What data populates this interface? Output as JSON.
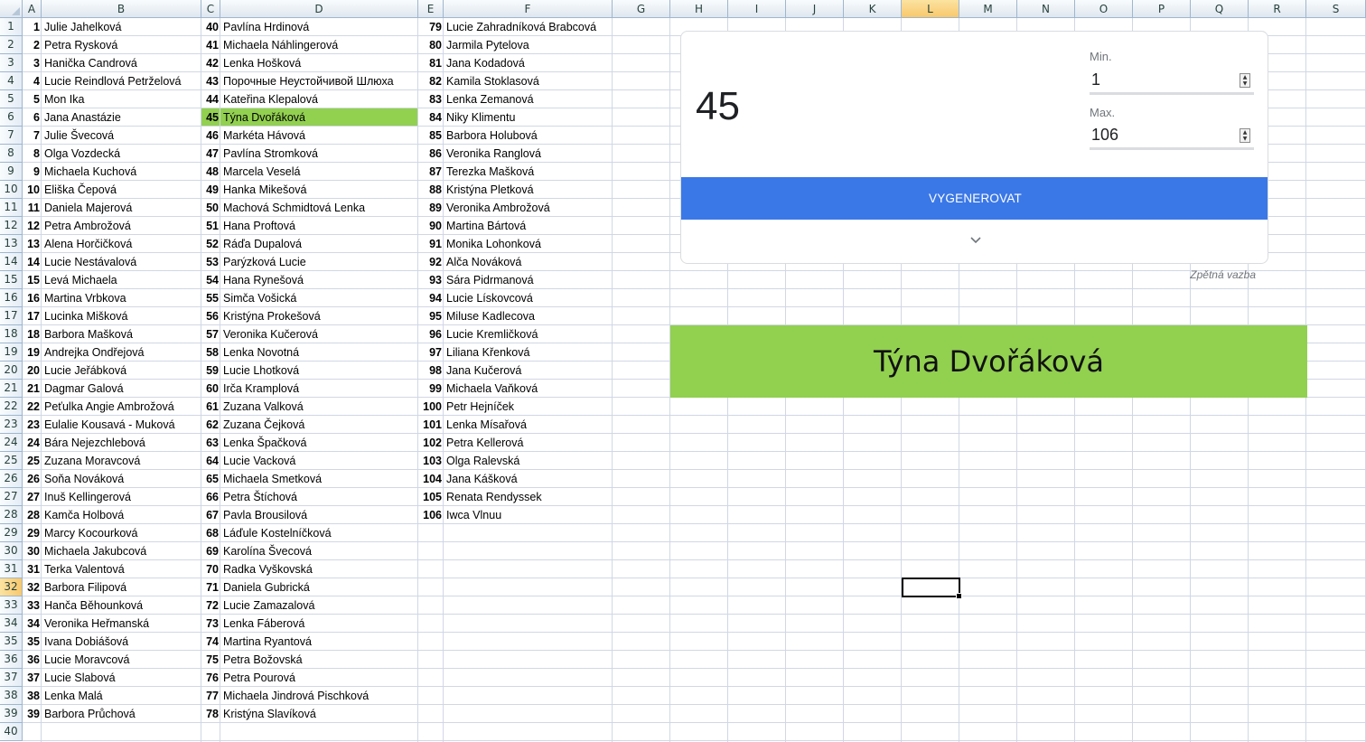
{
  "columns": [
    "A",
    "B",
    "C",
    "D",
    "E",
    "F",
    "G",
    "H",
    "I",
    "J",
    "K",
    "L",
    "M",
    "N",
    "O",
    "P",
    "Q",
    "R",
    "S"
  ],
  "selected_column": "L",
  "selected_row": 32,
  "row_count": 40,
  "col1": [
    "Julie Jahelková",
    "Petra Rysková",
    "Hanička Candrová",
    "Lucie Reindlová Petrželová",
    "Mon Ika",
    "Jana Anastázie",
    "Julie Švecová",
    "Olga Vozdecká",
    "Michaela Kuchová",
    "Eliška Čepová",
    "Daniela Majerová",
    "Petra Ambrožová",
    "Alena Horčičková",
    "Lucie Nestávalová",
    "Levá Michaela",
    "Martina Vrbkova",
    "Lucinka Mišková",
    "Barbora Mašková",
    "Andrejka Ondřejová",
    "Lucie Jeřábková",
    "Dagmar Galová",
    "Peťulka Angie Ambrožová",
    "Eulalie Kousavá - Muková",
    "Bára Nejezchlebová",
    "Zuzana Moravcová",
    "Soňa Nováková",
    "Inuš Kellingerová",
    "Kamča Holbová",
    "Marcy Kocourková",
    "Michaela Jakubcová",
    "Terka Valentová",
    "Barbora Filipová",
    "Hanča Běhounková",
    "Veronika Heřmanská",
    "Ivana Dobiášová",
    "Lucie Moravcová",
    "Lucie Slabová",
    "Lenka Malá",
    "Barbora Průchová"
  ],
  "col2": [
    "Pavlína Hrdinová",
    "Michaela Náhlingerová",
    "Lenka Hošková",
    "Порочные Неустойчивой Шлюха",
    "Kateřina Klepalová",
    "Týna Dvořáková",
    "Markéta Hávová",
    "Pavlína Stromková",
    "Marcela Veselá",
    "Hanka Mikešová",
    "Machová Schmidtová Lenka",
    "Hana Proftová",
    "Ráďa Dupalová",
    "Parýzková Lucie",
    "Hana Rynešová",
    "Simča Vošická",
    "Kristýna Prokešová",
    "Veronika Kučerová",
    "Lenka Novotná",
    "Lucie Lhotková",
    "Irča Kramplová",
    "Zuzana Valková",
    "Zuzana Čejková",
    "Lenka Špačková",
    "Lucie Vacková",
    "Michaela Smetková",
    "Petra Štíchová",
    "Pavla Brousilová",
    "Láďule Kostelníčková",
    "Karolína Švecová",
    "Radka Vyškovská",
    "Daniela Gubrická",
    "Lucie Zamazalová",
    "Lenka Fáberová",
    "Martina Ryantová",
    "Petra Božovská",
    "Petra Pourová",
    "Michaela Jindrová Pischková",
    "Kristýna Slavíková"
  ],
  "col3": [
    "Lucie Zahradníková Brabcová",
    "Jarmila Pytelova",
    "Jana Kodadová",
    "Kamila Stoklasová",
    "Lenka Zemanová",
    "Niky Klimentu",
    "Barbora Holubová",
    "Veronika Ranglová",
    "Terezka Mašková",
    "Kristýna Pletková",
    "Veronika Ambrožová",
    "Martina Bártová",
    "Monika Lohonková",
    "Alča Nováková",
    "Sára Pidrmanová",
    "Lucie Lískovcová",
    "Miluse Kadlecova",
    "Lucie Kremličková",
    "Liliana Křenková",
    "Jana Kučerová",
    "Michaela Vaňková",
    "Petr Hejníček",
    "Lenka Mísařová",
    "Petra Kellerová",
    "Olga Ralevská",
    "Jana Kášková",
    "Renata Rendyssek",
    "Iwca Vlnuu"
  ],
  "highlight_number": 45,
  "widget": {
    "result": "45",
    "min_label": "Min.",
    "min_value": "1",
    "max_label": "Max.",
    "max_value": "106",
    "generate_label": "VYGENEROVAT",
    "feedback_label": "Zpětná vazba"
  },
  "winner_name": "Týna Dvořáková",
  "colors": {
    "highlight": "#92d050",
    "button": "#3b78e7"
  }
}
